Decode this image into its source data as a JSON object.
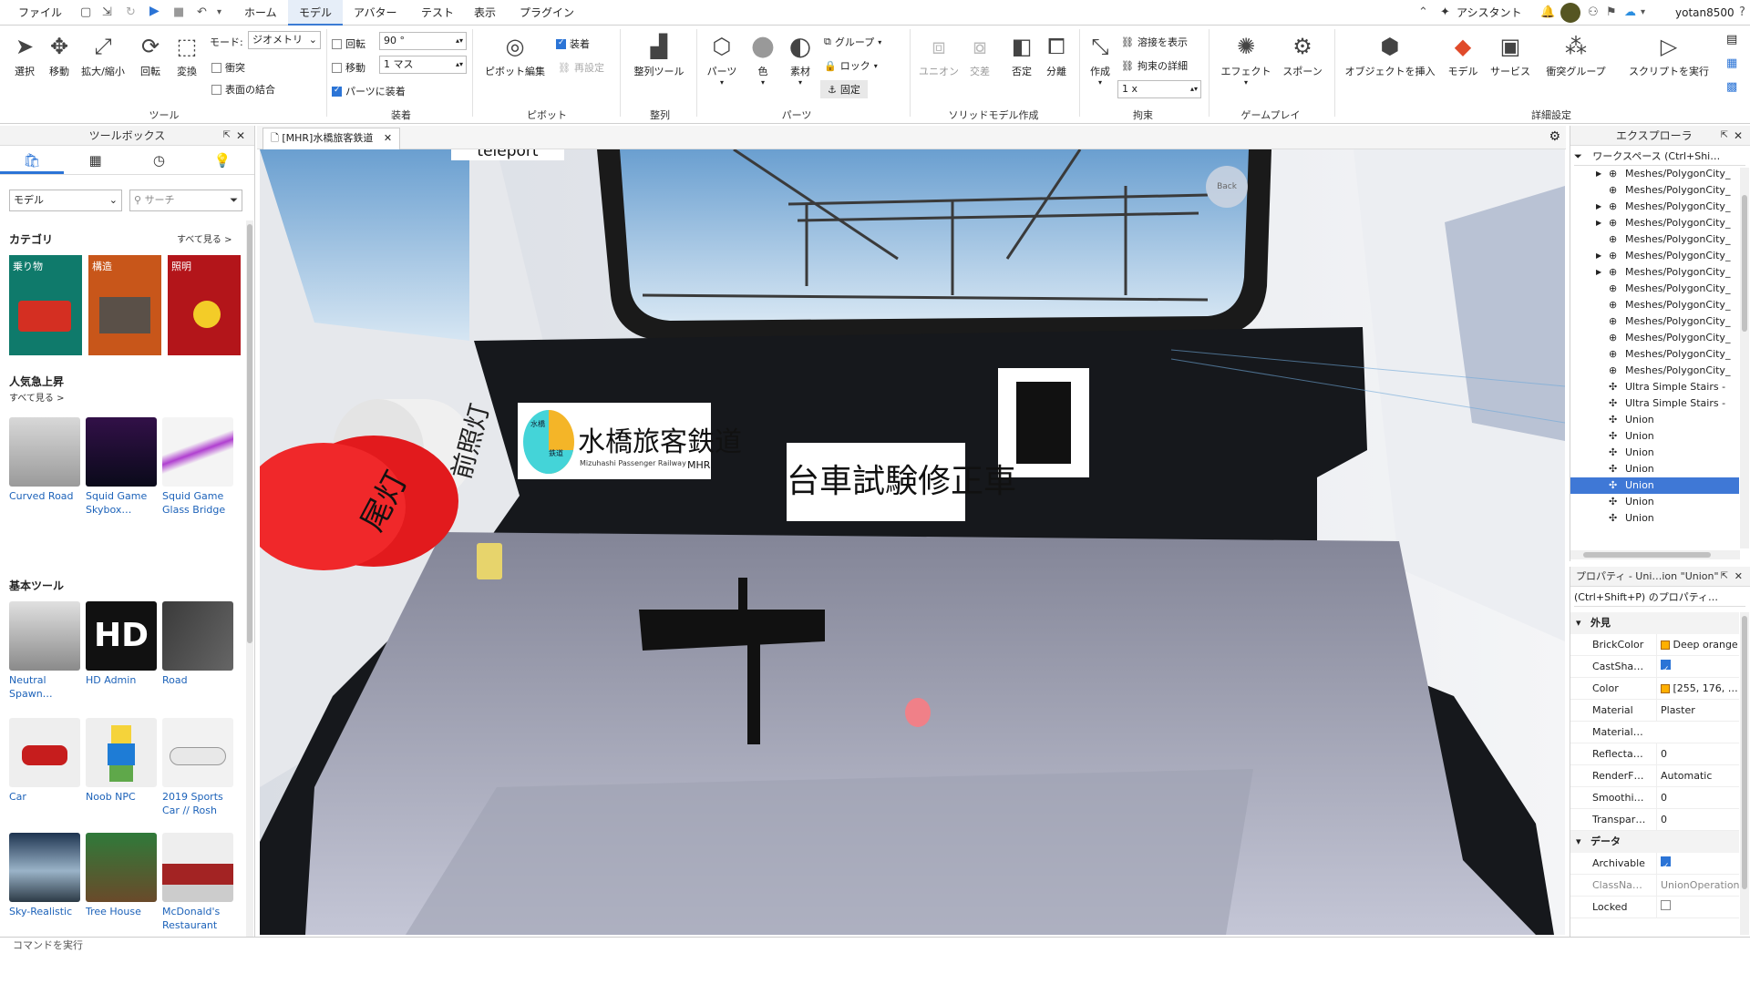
{
  "menubar": {
    "items": [
      "ファイル",
      "ホーム",
      "モデル",
      "アバター",
      "テスト",
      "表示",
      "プラグイン"
    ],
    "active": "モデル",
    "assistant": "アシスタント",
    "user": "yotan8500"
  },
  "ribbon": {
    "tool_group": {
      "buttons": [
        "選択",
        "移動",
        "拡大/縮小",
        "回転",
        "変換"
      ],
      "mode_label": "モード:",
      "mode_value": "ジオメトリ",
      "collision": "衝突",
      "surface_join": "表面の結合",
      "group_label": "ツール"
    },
    "snap_group": {
      "rotate_label": "回転",
      "rotate_value": "90 °",
      "move_label": "移動",
      "move_value": "1 マス",
      "weld_parts": "パーツに装着",
      "group_label": "装着"
    },
    "pivot_group": {
      "edit": "ピボット編集",
      "attach": "装着",
      "reset": "再設定",
      "group_label": "ピボット"
    },
    "align_group": {
      "align_tool": "整列ツール",
      "group_label": "整列"
    },
    "parts_group": {
      "buttons": [
        "パーツ",
        "色",
        "素材"
      ],
      "group_btn": "グループ",
      "lock_btn": "ロック",
      "anchor_btn": "固定",
      "group_label": "パーツ"
    },
    "solid_group": {
      "buttons": [
        "ユニオン",
        "交差",
        "否定",
        "分離"
      ],
      "group_label": "ソリッドモデル作成"
    },
    "constraint_group": {
      "create": "作成",
      "show_welds": "溶接を表示",
      "constraint_details": "拘束の詳細",
      "scale_value": "1 x",
      "group_label": "拘束"
    },
    "gameplay_group": {
      "buttons": [
        "エフェクト",
        "スポーン"
      ],
      "group_label": "ゲームプレイ"
    },
    "advanced_group": {
      "buttons": [
        "オブジェクトを挿入",
        "モデル",
        "サービス",
        "衝突グループ",
        "スクリプトを実行"
      ],
      "group_label": "詳細設定"
    }
  },
  "toolbox": {
    "title": "ツールボックス",
    "filter_value": "モデル",
    "search_placeholder": "サーチ",
    "categories_title": "カテゴリ",
    "see_all": "すべて見る >",
    "categories": [
      "乗り物",
      "構造",
      "照明"
    ],
    "trending_title": "人気急上昇",
    "trending_see_all": "すべて見る >",
    "trending": [
      "Curved Road",
      "Squid Game Skybox…",
      "Squid Game Glass Bridge"
    ],
    "basic_title": "基本ツール",
    "basic": [
      "Neutral Spawn…",
      "HD Admin",
      "Road",
      "Car",
      "Noob NPC",
      "2019 Sports Car // Rosh",
      "Sky-Realistic",
      "Tree House",
      "McDonald's Restaurant"
    ]
  },
  "document_tab": {
    "title": "[MHR]水橋旅客鉄道"
  },
  "viewport": {
    "teleport": "teleport",
    "tail_light": "尾灯",
    "head_light": "前照灯",
    "company_name": "水橋旅客鉄道",
    "company_en": "Mizuhashi Passenger Railway",
    "company_code": "MHR",
    "logo_top": "水橋",
    "logo_bottom": "鉄道",
    "vehicle_sign": "台車試験修正車",
    "back": "Back"
  },
  "explorer": {
    "title": "エクスプローラ",
    "filter": "ワークスペース (Ctrl+Shi…",
    "items": [
      "Meshes/PolygonCity_",
      "Meshes/PolygonCity_",
      "Meshes/PolygonCity_",
      "Meshes/PolygonCity_",
      "Meshes/PolygonCity_",
      "Meshes/PolygonCity_",
      "Meshes/PolygonCity_",
      "Meshes/PolygonCity_",
      "Meshes/PolygonCity_",
      "Meshes/PolygonCity_",
      "Meshes/PolygonCity_",
      "Meshes/PolygonCity_",
      "Meshes/PolygonCity_",
      "Ultra Simple Stairs - ",
      "Ultra Simple Stairs - ",
      "Union",
      "Union",
      "Union",
      "Union",
      "Union",
      "Union",
      "Union"
    ],
    "selected_index": 19
  },
  "properties": {
    "title": "プロパティ - Uni…ion \"Union\"",
    "filter": "(Ctrl+Shift+P) のプロパティ…",
    "appearance_header": "外見",
    "data_header": "データ",
    "appearance": [
      {
        "key": "BrickColor",
        "value": "Deep orange"
      },
      {
        "key": "CastSha…",
        "value": ""
      },
      {
        "key": "Color",
        "value": "[255, 176, …"
      },
      {
        "key": "Material",
        "value": "Plaster"
      },
      {
        "key": "Material…",
        "value": ""
      },
      {
        "key": "Reflecta…",
        "value": "0"
      },
      {
        "key": "RenderF…",
        "value": "Automatic"
      },
      {
        "key": "Smoothi…",
        "value": "0"
      },
      {
        "key": "Transpar…",
        "value": "0"
      }
    ],
    "data": [
      {
        "key": "Archivable",
        "value": ""
      },
      {
        "key": "ClassNa…",
        "value": "UnionOperation"
      },
      {
        "key": "Locked",
        "value": ""
      }
    ]
  },
  "command_bar": {
    "placeholder": "コマンドを実行"
  },
  "colors": {
    "accent": "#2b74d6",
    "selection": "#3f78d6",
    "brick_color": "#ffb000",
    "tail_light": "#e8191c"
  }
}
